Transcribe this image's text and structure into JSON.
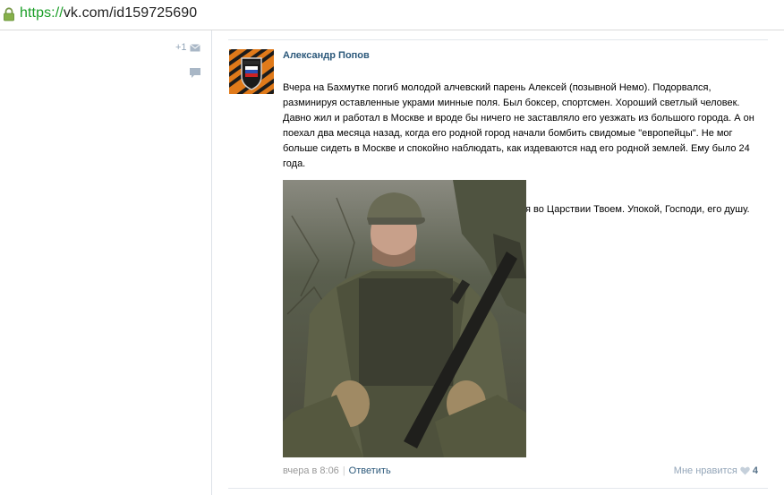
{
  "browser": {
    "url_scheme": "https://",
    "url_rest": "vk.com/id159725690"
  },
  "left_panel": {
    "plus_one": "+1"
  },
  "post": {
    "author": "Александр Попов",
    "paragraph_1": "Вчера на Бахмутке погиб молодой алчевский парень Алексей (позывной Немо). Подорвался, разминируя оставленные украми минные поля. Был боксер, спортсмен. Хороший светлый человек. Давно жил и работал в Москве и вроде бы ничего не заставляло его уезжать из большого города. А он поехал два месяца назад, когда его родной город начали бомбить свидомые \"европейцы\". Не мог больше сидеть в Москве и спокойно наблюдать, как издеваются над его родной землей. Ему было 24 года.",
    "paragraph_2": "Помяни, Господи, новопреставленного воина Алексея во Царствии Твоем. Упокой, Господи, его душу.",
    "timestamp": "вчера в 8:06",
    "separator": "|",
    "reply_label": "Ответить",
    "like_label": "Мне нравится",
    "like_count": "4"
  },
  "icons": {
    "lock": "lock-icon",
    "mail": "mail-icon",
    "comment": "comment-icon",
    "heart": "heart-icon"
  },
  "colors": {
    "link": "#2b587a",
    "muted": "#999999",
    "secure_green": "#1a9e27"
  }
}
